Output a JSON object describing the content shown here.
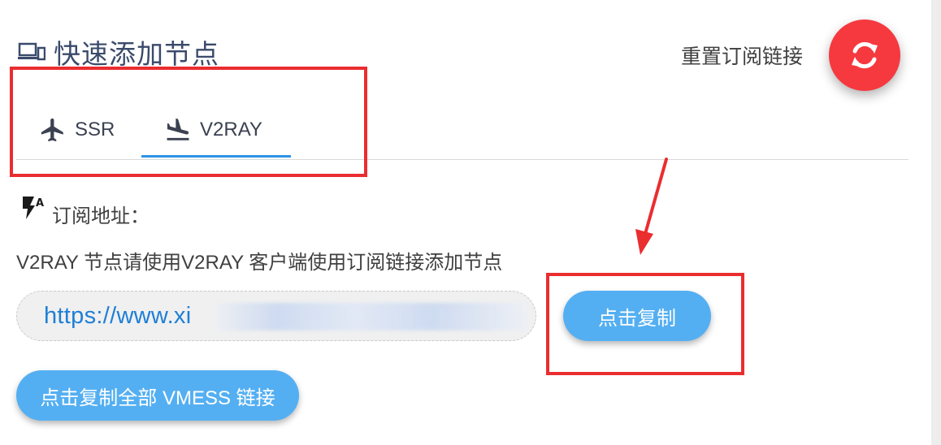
{
  "header": {
    "title": "快速添加节点",
    "title_icon": "devices-icon",
    "reset_label": "重置订阅链接",
    "reset_icon": "refresh-icon"
  },
  "tabs": [
    {
      "label": "SSR",
      "icon": "airplane-icon",
      "active": false
    },
    {
      "label": "V2RAY",
      "icon": "flight-land-icon",
      "active": true
    }
  ],
  "subscription": {
    "icon": "flash-auto-icon",
    "label": "订阅地址：",
    "description": "V2RAY 节点请使用V2RAY 客户端使用订阅链接添加节点",
    "url_value": "https://www.xi",
    "copy_button": "点击复制",
    "copy_all_button": "点击复制全部 VMESS 链接"
  },
  "colors": {
    "accent_blue": "#54aff2",
    "tab_active": "#2f93e6",
    "reset_red": "#f5393f",
    "annotation_red": "#ea2d2f"
  }
}
